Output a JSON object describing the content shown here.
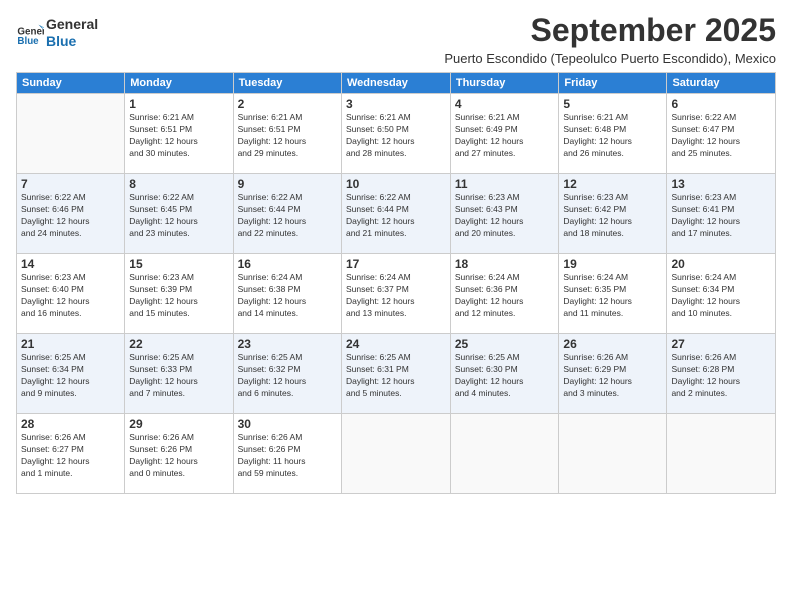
{
  "logo": {
    "line1": "General",
    "line2": "Blue"
  },
  "title": "September 2025",
  "subtitle": "Puerto Escondido (Tepeolulco Puerto Escondido), Mexico",
  "days_of_week": [
    "Sunday",
    "Monday",
    "Tuesday",
    "Wednesday",
    "Thursday",
    "Friday",
    "Saturday"
  ],
  "weeks": [
    [
      {
        "day": "",
        "info": ""
      },
      {
        "day": "1",
        "info": "Sunrise: 6:21 AM\nSunset: 6:51 PM\nDaylight: 12 hours\nand 30 minutes."
      },
      {
        "day": "2",
        "info": "Sunrise: 6:21 AM\nSunset: 6:51 PM\nDaylight: 12 hours\nand 29 minutes."
      },
      {
        "day": "3",
        "info": "Sunrise: 6:21 AM\nSunset: 6:50 PM\nDaylight: 12 hours\nand 28 minutes."
      },
      {
        "day": "4",
        "info": "Sunrise: 6:21 AM\nSunset: 6:49 PM\nDaylight: 12 hours\nand 27 minutes."
      },
      {
        "day": "5",
        "info": "Sunrise: 6:21 AM\nSunset: 6:48 PM\nDaylight: 12 hours\nand 26 minutes."
      },
      {
        "day": "6",
        "info": "Sunrise: 6:22 AM\nSunset: 6:47 PM\nDaylight: 12 hours\nand 25 minutes."
      }
    ],
    [
      {
        "day": "7",
        "info": "Sunrise: 6:22 AM\nSunset: 6:46 PM\nDaylight: 12 hours\nand 24 minutes."
      },
      {
        "day": "8",
        "info": "Sunrise: 6:22 AM\nSunset: 6:45 PM\nDaylight: 12 hours\nand 23 minutes."
      },
      {
        "day": "9",
        "info": "Sunrise: 6:22 AM\nSunset: 6:44 PM\nDaylight: 12 hours\nand 22 minutes."
      },
      {
        "day": "10",
        "info": "Sunrise: 6:22 AM\nSunset: 6:44 PM\nDaylight: 12 hours\nand 21 minutes."
      },
      {
        "day": "11",
        "info": "Sunrise: 6:23 AM\nSunset: 6:43 PM\nDaylight: 12 hours\nand 20 minutes."
      },
      {
        "day": "12",
        "info": "Sunrise: 6:23 AM\nSunset: 6:42 PM\nDaylight: 12 hours\nand 18 minutes."
      },
      {
        "day": "13",
        "info": "Sunrise: 6:23 AM\nSunset: 6:41 PM\nDaylight: 12 hours\nand 17 minutes."
      }
    ],
    [
      {
        "day": "14",
        "info": "Sunrise: 6:23 AM\nSunset: 6:40 PM\nDaylight: 12 hours\nand 16 minutes."
      },
      {
        "day": "15",
        "info": "Sunrise: 6:23 AM\nSunset: 6:39 PM\nDaylight: 12 hours\nand 15 minutes."
      },
      {
        "day": "16",
        "info": "Sunrise: 6:24 AM\nSunset: 6:38 PM\nDaylight: 12 hours\nand 14 minutes."
      },
      {
        "day": "17",
        "info": "Sunrise: 6:24 AM\nSunset: 6:37 PM\nDaylight: 12 hours\nand 13 minutes."
      },
      {
        "day": "18",
        "info": "Sunrise: 6:24 AM\nSunset: 6:36 PM\nDaylight: 12 hours\nand 12 minutes."
      },
      {
        "day": "19",
        "info": "Sunrise: 6:24 AM\nSunset: 6:35 PM\nDaylight: 12 hours\nand 11 minutes."
      },
      {
        "day": "20",
        "info": "Sunrise: 6:24 AM\nSunset: 6:34 PM\nDaylight: 12 hours\nand 10 minutes."
      }
    ],
    [
      {
        "day": "21",
        "info": "Sunrise: 6:25 AM\nSunset: 6:34 PM\nDaylight: 12 hours\nand 9 minutes."
      },
      {
        "day": "22",
        "info": "Sunrise: 6:25 AM\nSunset: 6:33 PM\nDaylight: 12 hours\nand 7 minutes."
      },
      {
        "day": "23",
        "info": "Sunrise: 6:25 AM\nSunset: 6:32 PM\nDaylight: 12 hours\nand 6 minutes."
      },
      {
        "day": "24",
        "info": "Sunrise: 6:25 AM\nSunset: 6:31 PM\nDaylight: 12 hours\nand 5 minutes."
      },
      {
        "day": "25",
        "info": "Sunrise: 6:25 AM\nSunset: 6:30 PM\nDaylight: 12 hours\nand 4 minutes."
      },
      {
        "day": "26",
        "info": "Sunrise: 6:26 AM\nSunset: 6:29 PM\nDaylight: 12 hours\nand 3 minutes."
      },
      {
        "day": "27",
        "info": "Sunrise: 6:26 AM\nSunset: 6:28 PM\nDaylight: 12 hours\nand 2 minutes."
      }
    ],
    [
      {
        "day": "28",
        "info": "Sunrise: 6:26 AM\nSunset: 6:27 PM\nDaylight: 12 hours\nand 1 minute."
      },
      {
        "day": "29",
        "info": "Sunrise: 6:26 AM\nSunset: 6:26 PM\nDaylight: 12 hours\nand 0 minutes."
      },
      {
        "day": "30",
        "info": "Sunrise: 6:26 AM\nSunset: 6:26 PM\nDaylight: 11 hours\nand 59 minutes."
      },
      {
        "day": "",
        "info": ""
      },
      {
        "day": "",
        "info": ""
      },
      {
        "day": "",
        "info": ""
      },
      {
        "day": "",
        "info": ""
      }
    ]
  ]
}
